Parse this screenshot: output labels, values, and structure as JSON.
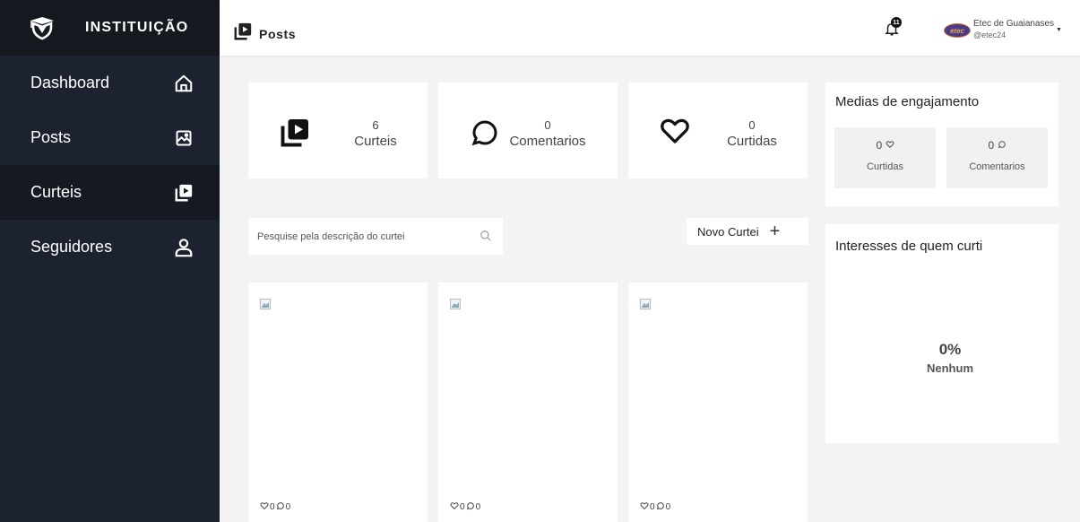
{
  "brand": {
    "name": "INSTITUIÇÃO",
    "logo_icon": "graduation-shield-icon"
  },
  "sidebar": {
    "items": [
      {
        "label": "Dashboard",
        "icon": "home-icon",
        "active": false
      },
      {
        "label": "Posts",
        "icon": "image-icon",
        "active": false
      },
      {
        "label": "Curteis",
        "icon": "video-library-icon",
        "active": true
      },
      {
        "label": "Seguidores",
        "icon": "user-icon",
        "active": false
      }
    ]
  },
  "header": {
    "title": "Posts",
    "notification_count": "11",
    "user": {
      "name": "Etec de Guaianases",
      "handle": "@etec24",
      "avatar_text": "etec"
    }
  },
  "stats": [
    {
      "value": "6",
      "label": "Curteis",
      "icon": "video-library-icon"
    },
    {
      "value": "0",
      "label": "Comentarios",
      "icon": "comment-icon"
    },
    {
      "value": "0",
      "label": "Curtidas",
      "icon": "heart-icon"
    }
  ],
  "engagement": {
    "title": "Medias de engajamento",
    "items": [
      {
        "value": "0",
        "label": "Curtidas",
        "icon": "heart-icon"
      },
      {
        "value": "0",
        "label": "Comentarios",
        "icon": "comment-icon"
      }
    ]
  },
  "search": {
    "placeholder": "Pesquise pela descrição do curtei",
    "value": ""
  },
  "new_button": {
    "label": "Novo Curtei"
  },
  "interests": {
    "title": "Interesses de quem curti",
    "percent": "0%",
    "label": "Nenhum"
  },
  "posts": [
    {
      "likes": "0",
      "comments": "0"
    },
    {
      "likes": "0",
      "comments": "0"
    },
    {
      "likes": "0",
      "comments": "0"
    }
  ],
  "colors": {
    "sidebar_bg": "#1c2230",
    "brand_bg": "#14181f",
    "active_bg": "#151a22",
    "page_bg": "#f3f3f3",
    "card_bg": "#ffffff"
  }
}
